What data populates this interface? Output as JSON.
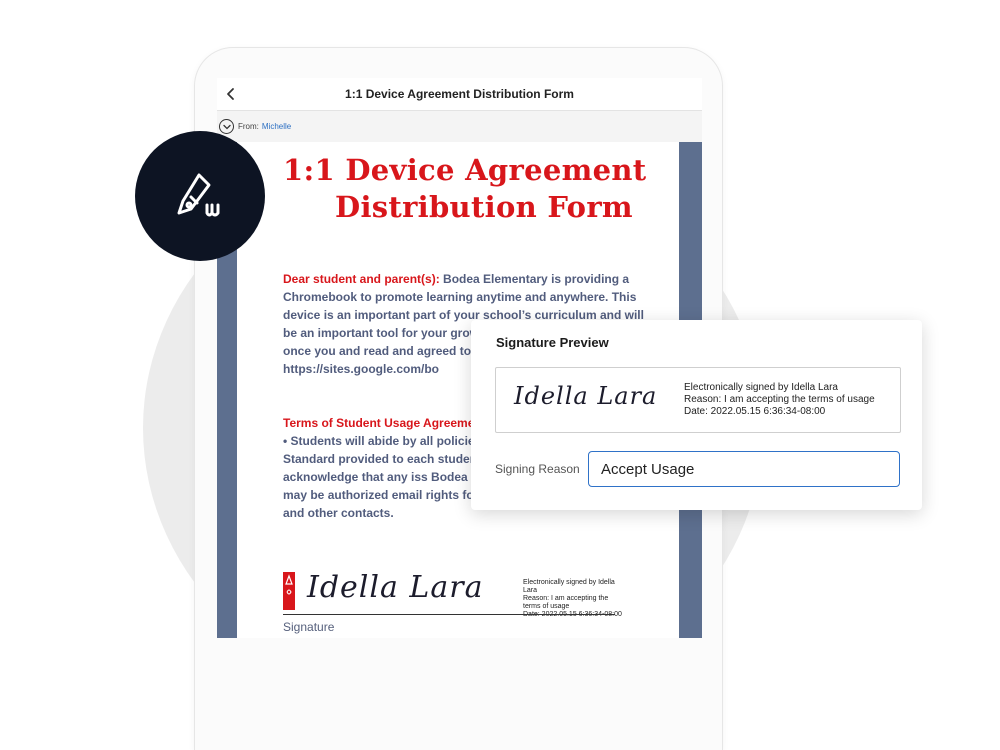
{
  "header": {
    "title": "1:1 Device Agreement Distribution Form",
    "from_label": "From:",
    "from_name": "Michelle"
  },
  "document": {
    "title_line1": "1:1 Device Agreement",
    "title_line2": "Distribution Form",
    "intro_lead": "Dear student and parent(s):",
    "intro_text": " Bodea Elementary is providing a Chromebook to promote learning anytime and anywhere. This device is an important part of your school’s curriculum and will be an important tool for your growth in take the device home once you and read and agreed to the terms on this website: https://sites.google.com/bo",
    "terms_heading": "Terms of Student Usage Agreement",
    "terms_text": "• Students will abide by all policies o Elementary School Board’s Standard provided to each student at the begi • Students acknowledge that any iss Bodea Elementary School. • Students may be authorized email rights for mailing other students, staff, and other contacts.",
    "signature_script": "Idella Lara",
    "signature_meta": [
      "Electronically signed by Idella Lara",
      "Reason: I am accepting the terms of usage",
      "Date: 2022.05.15 6:36:34-08:00"
    ],
    "signature_label": "Signature"
  },
  "preview": {
    "title": "Signature Preview",
    "signature_script": "Idella Lara",
    "meta": [
      "Electronically signed by Idella Lara",
      "Reason: I am accepting the terms of usage",
      "Date: 2022.05.15 6:36:34-08:00"
    ],
    "reason_label": "Signing Reason",
    "reason_value": "Accept Usage"
  },
  "colors": {
    "accent_red": "#d8161b",
    "doc_border": "#5d6f8f",
    "input_blue": "#2f72c8",
    "badge_dark": "#0d1423"
  },
  "icons": {
    "back": "chevron-left-icon",
    "expand": "chevron-down-icon",
    "badge": "pen-signature-icon",
    "brand": "acrobat-logo-icon"
  }
}
